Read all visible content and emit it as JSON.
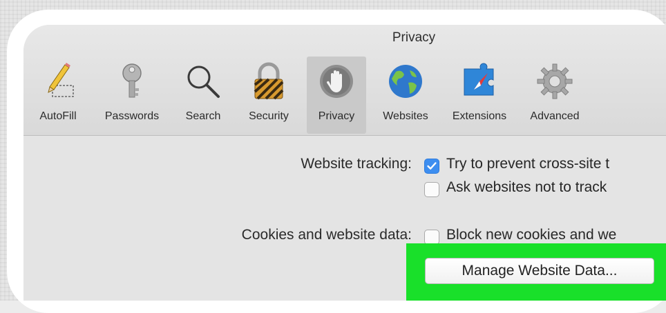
{
  "window": {
    "title": "Privacy"
  },
  "toolbar": {
    "items": [
      {
        "label": "AutoFill",
        "icon": "pencil-icon"
      },
      {
        "label": "Passwords",
        "icon": "key-icon"
      },
      {
        "label": "Search",
        "icon": "magnifier-icon"
      },
      {
        "label": "Security",
        "icon": "padlock-icon"
      },
      {
        "label": "Privacy",
        "icon": "hand-icon",
        "selected": true
      },
      {
        "label": "Websites",
        "icon": "globe-icon"
      },
      {
        "label": "Extensions",
        "icon": "puzzle-compass-icon"
      },
      {
        "label": "Advanced",
        "icon": "gear-icon"
      }
    ]
  },
  "privacy": {
    "website_tracking_label": "Website tracking:",
    "prevent_cross_site_text": "Try to prevent cross-site t",
    "prevent_cross_site_checked": true,
    "ask_not_track_text": "Ask websites not to track",
    "ask_not_track_checked": false,
    "cookies_label": "Cookies and website data:",
    "block_cookies_text": "Block new cookies and we",
    "block_cookies_checked": false,
    "manage_button": "Manage Website Data..."
  },
  "colors": {
    "highlight": "#19e02a",
    "checkbox_accent": "#3d8ef0"
  }
}
